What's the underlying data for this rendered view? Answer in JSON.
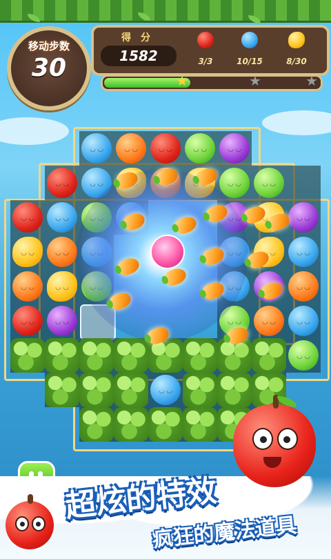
{
  "header": {
    "moves_label": "移动步数",
    "moves_value": "30",
    "score_label": "得分",
    "score_value": "1582",
    "goals": [
      {
        "icon": "apple-icon",
        "text": "3/3",
        "color": "#e0241a"
      },
      {
        "icon": "blueberry-icon",
        "text": "10/15",
        "color": "#3aa7ee"
      },
      {
        "icon": "lemon-icon",
        "text": "8/30",
        "color": "#ffc21a"
      }
    ],
    "progress_fraction": 0.4,
    "stars_earned": 1,
    "stars_total": 3
  },
  "board": {
    "special_effect": "vortex-swirl"
  },
  "footer": {
    "slogan_line1": "超炫的特效",
    "slogan_line2": "疯狂的魔法道具",
    "pause_icon": "pause-icon"
  },
  "colors": {
    "apple": "#e0241a",
    "blueberry": "#3aa7ee",
    "orange": "#ff7a1a",
    "lime": "#6fd43a",
    "grape": "#9a3ad8",
    "lemon": "#ffc21a",
    "board_frame": "#f1d785"
  }
}
